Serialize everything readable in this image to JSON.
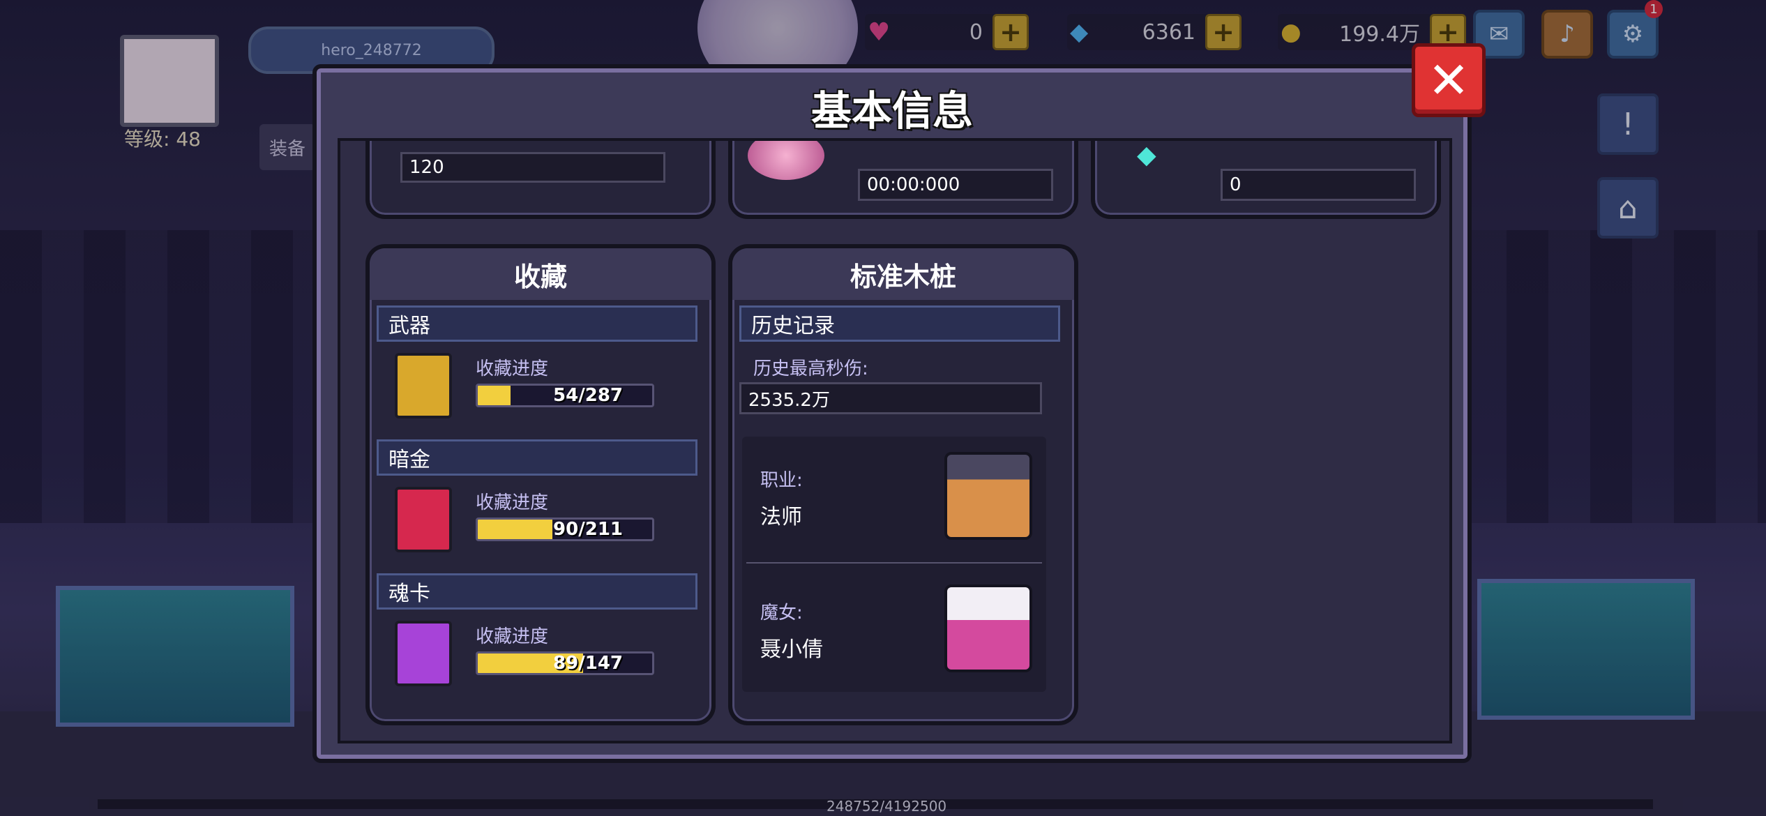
{
  "hud": {
    "username": "hero_248772",
    "level_label": "等级: 48",
    "tab_partial": "装备",
    "currency_hearts": "0",
    "currency_diamonds": "6361",
    "currency_gold": "199.4万",
    "settings_badge": "1",
    "progress_text": "248752/4192500",
    "plus_symbol": "+"
  },
  "modal": {
    "title": "基本信息",
    "close_symbol": "✕",
    "top_row": {
      "left_value": "120",
      "middle_value": "00:00:000",
      "right_value": "0"
    },
    "collection": {
      "title": "收藏",
      "progress_label": "收藏进度",
      "categories": [
        {
          "name": "武器",
          "current": 54,
          "total": 287,
          "text": "54/287",
          "color": "#d9a82c"
        },
        {
          "name": "暗金",
          "current": 90,
          "total": 211,
          "text": "90/211",
          "color": "#d6284e"
        },
        {
          "name": "魂卡",
          "current": 89,
          "total": 147,
          "text": "89/147",
          "color": "#a743d8"
        }
      ]
    },
    "dummy": {
      "title": "标准木桩",
      "history_header": "历史记录",
      "max_dps_label": "历史最高秒伤:",
      "max_dps_value": "2535.2万",
      "job_label": "职业:",
      "job_value": "法师",
      "witch_label": "魔女:",
      "witch_value": "聂小倩"
    }
  },
  "colors": {
    "accent_gold": "#f2cf3e",
    "close_red": "#e03333",
    "panel": "#26243a"
  }
}
